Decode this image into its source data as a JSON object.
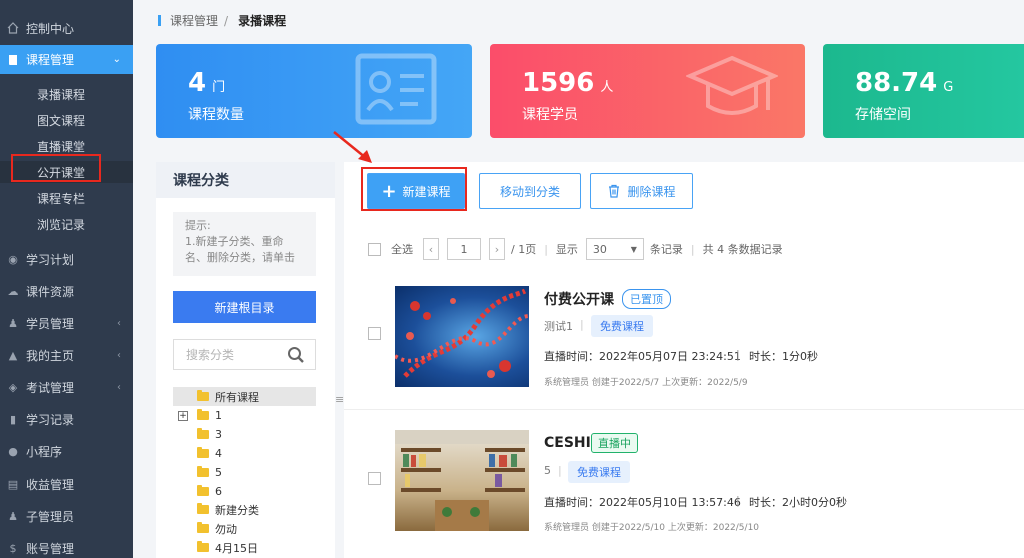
{
  "sidebar": {
    "items": [
      {
        "label": "控制中心",
        "icon": "home-icon"
      },
      {
        "label": "课程管理",
        "icon": "book-icon"
      },
      {
        "label": "学习计划",
        "icon": "eye-icon"
      },
      {
        "label": "课件资源",
        "icon": "cloud-icon"
      },
      {
        "label": "学员管理",
        "icon": "users-icon"
      },
      {
        "label": "我的主页",
        "icon": "graduation-icon"
      },
      {
        "label": "考试管理",
        "icon": "tag-icon"
      },
      {
        "label": "学习记录",
        "icon": "book-icon"
      },
      {
        "label": "小程序",
        "icon": "wechat-icon"
      },
      {
        "label": "收益管理",
        "icon": "card-icon"
      },
      {
        "label": "子管理员",
        "icon": "user-icon"
      },
      {
        "label": "账号管理",
        "icon": "dollar-icon"
      }
    ],
    "sub_items": [
      "录播课程",
      "图文课程",
      "直播课堂",
      "公开课堂",
      "课程专栏",
      "浏览记录"
    ]
  },
  "breadcrumb": {
    "parent": "课程管理",
    "sep": "/",
    "current": "录播课程"
  },
  "stats": [
    {
      "value": "4",
      "unit": "门",
      "label": "课程数量"
    },
    {
      "value": "1596",
      "unit": "人",
      "label": "课程学员"
    },
    {
      "value": "88.74",
      "unit": "G",
      "label": "存储空间"
    }
  ],
  "category": {
    "title": "课程分类",
    "tip": "提示:\n1.新建子分类、重命名、删除分类，请单击",
    "new_root_label": "新建根目录",
    "search_placeholder": "搜索分类",
    "tree": [
      "所有课程",
      "1",
      "3",
      "4",
      "5",
      "6",
      "新建分类",
      "勿动",
      "4月15日"
    ]
  },
  "toolbar": {
    "new_course": "新建课程",
    "move_to_category": "移动到分类",
    "delete_course": "删除课程"
  },
  "pager": {
    "select_all": "全选",
    "page": "1",
    "total_pages": "/ 1页",
    "show": "显示",
    "per_page": "30",
    "records_label": "条记录",
    "total": "共 4 条数据记录"
  },
  "courses": [
    {
      "title": "付费公开课",
      "badge": "已置顶",
      "teacher": "测试1",
      "price_tag": "免费课程",
      "time": "直播时间：2022年05月07日 23:24:51",
      "duration": "时长：1分0秒",
      "footer": "系统管理员 创建于2022/5/7 上次更新：2022/5/9"
    },
    {
      "title": "CESHI",
      "badge": "直播中",
      "teacher": "5",
      "price_tag": "免费课程",
      "time": "直播时间：2022年05月10日 13:57:46",
      "duration": "时长：2小时0分0秒",
      "footer": "系统管理员 创建于2022/5/10 上次更新：2022/5/10"
    }
  ]
}
